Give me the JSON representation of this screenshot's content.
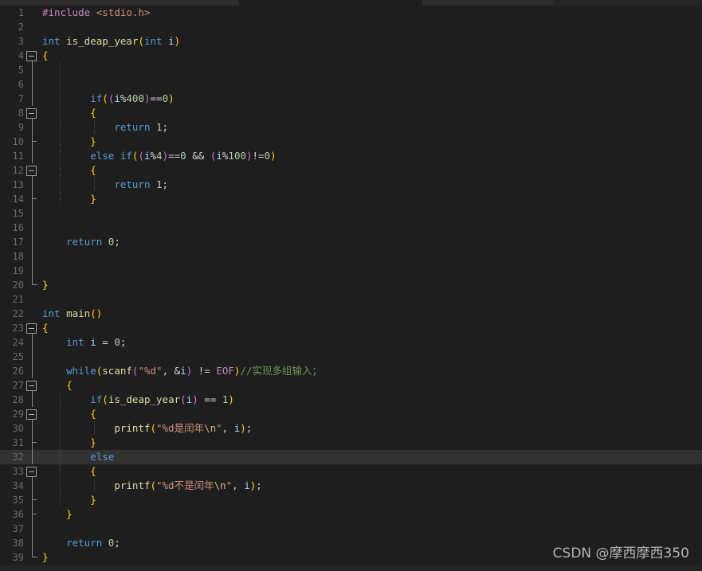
{
  "editor": {
    "language": "C",
    "theme": "dark-plus",
    "current_line": 32,
    "first_line": 1,
    "last_line": 39,
    "line_height_px": 18,
    "colors": {
      "background": "#1e1e1e",
      "current_line_background": "#323232",
      "gutter_foreground": "#6a6a6a",
      "keyword": "#569cd6",
      "function": "#dcdcaa",
      "string": "#ce9178",
      "number": "#b5cea8",
      "comment": "#6a9955",
      "variable": "#9cdcfe",
      "macro": "#c586c0",
      "escape": "#d7ba7d",
      "plain": "#d4d4d4"
    }
  },
  "watermark": {
    "text": "CSDN @摩西摩西350"
  },
  "code_lines": [
    {
      "n": 1,
      "fold": "none",
      "guides": [],
      "tokens": [
        {
          "c": "macro",
          "t": "#include"
        },
        {
          "c": "plain",
          "t": " "
        },
        {
          "c": "hdr",
          "t": "<stdio.h>"
        }
      ]
    },
    {
      "n": 2,
      "fold": "none",
      "guides": [],
      "tokens": []
    },
    {
      "n": 3,
      "fold": "none",
      "guides": [],
      "tokens": [
        {
          "c": "type",
          "t": "int"
        },
        {
          "c": "plain",
          "t": " "
        },
        {
          "c": "fn",
          "t": "is_deap_year"
        },
        {
          "c": "brace3",
          "t": "("
        },
        {
          "c": "type",
          "t": "int"
        },
        {
          "c": "plain",
          "t": " "
        },
        {
          "c": "var",
          "t": "i"
        },
        {
          "c": "brace3",
          "t": ")"
        }
      ]
    },
    {
      "n": 4,
      "fold": "open",
      "guides": [],
      "tokens": [
        {
          "c": "brace3",
          "t": "{"
        }
      ]
    },
    {
      "n": 5,
      "fold": "stem",
      "guides": [
        75
      ],
      "tokens": []
    },
    {
      "n": 6,
      "fold": "stem",
      "guides": [
        75
      ],
      "tokens": []
    },
    {
      "n": 7,
      "fold": "stem",
      "guides": [
        75
      ],
      "tokens": [
        {
          "c": "plain",
          "t": "        "
        },
        {
          "c": "kw",
          "t": "if"
        },
        {
          "c": "brace3",
          "t": "("
        },
        {
          "c": "brace",
          "t": "("
        },
        {
          "c": "var",
          "t": "i"
        },
        {
          "c": "op",
          "t": "%"
        },
        {
          "c": "num",
          "t": "400"
        },
        {
          "c": "brace",
          "t": ")"
        },
        {
          "c": "op",
          "t": "=="
        },
        {
          "c": "num",
          "t": "0"
        },
        {
          "c": "brace3",
          "t": ")"
        }
      ]
    },
    {
      "n": 8,
      "fold": "open",
      "guides": [
        75
      ],
      "tokens": [
        {
          "c": "plain",
          "t": "        "
        },
        {
          "c": "brace3",
          "t": "{"
        }
      ]
    },
    {
      "n": 9,
      "fold": "stem",
      "guides": [
        75,
        118
      ],
      "tokens": [
        {
          "c": "plain",
          "t": "            "
        },
        {
          "c": "kw",
          "t": "return"
        },
        {
          "c": "plain",
          "t": " "
        },
        {
          "c": "num",
          "t": "1"
        },
        {
          "c": "punc",
          "t": ";"
        }
      ]
    },
    {
      "n": 10,
      "fold": "end",
      "guides": [
        75
      ],
      "tokens": [
        {
          "c": "plain",
          "t": "        "
        },
        {
          "c": "brace3",
          "t": "}"
        }
      ]
    },
    {
      "n": 11,
      "fold": "stem",
      "guides": [
        75
      ],
      "tokens": [
        {
          "c": "plain",
          "t": "        "
        },
        {
          "c": "kw",
          "t": "else"
        },
        {
          "c": "plain",
          "t": " "
        },
        {
          "c": "kw",
          "t": "if"
        },
        {
          "c": "brace3",
          "t": "("
        },
        {
          "c": "brace",
          "t": "("
        },
        {
          "c": "var",
          "t": "i"
        },
        {
          "c": "op",
          "t": "%"
        },
        {
          "c": "num",
          "t": "4"
        },
        {
          "c": "brace",
          "t": ")"
        },
        {
          "c": "op",
          "t": "=="
        },
        {
          "c": "num",
          "t": "0"
        },
        {
          "c": "plain",
          "t": " "
        },
        {
          "c": "op",
          "t": "&&"
        },
        {
          "c": "plain",
          "t": " "
        },
        {
          "c": "brace",
          "t": "("
        },
        {
          "c": "var",
          "t": "i"
        },
        {
          "c": "op",
          "t": "%"
        },
        {
          "c": "num",
          "t": "100"
        },
        {
          "c": "brace",
          "t": ")"
        },
        {
          "c": "op",
          "t": "!="
        },
        {
          "c": "num",
          "t": "0"
        },
        {
          "c": "brace3",
          "t": ")"
        }
      ]
    },
    {
      "n": 12,
      "fold": "open",
      "guides": [
        75
      ],
      "tokens": [
        {
          "c": "plain",
          "t": "        "
        },
        {
          "c": "brace3",
          "t": "{"
        }
      ]
    },
    {
      "n": 13,
      "fold": "stem",
      "guides": [
        75,
        118
      ],
      "tokens": [
        {
          "c": "plain",
          "t": "            "
        },
        {
          "c": "kw",
          "t": "return"
        },
        {
          "c": "plain",
          "t": " "
        },
        {
          "c": "num",
          "t": "1"
        },
        {
          "c": "punc",
          "t": ";"
        }
      ]
    },
    {
      "n": 14,
      "fold": "end",
      "guides": [
        75
      ],
      "tokens": [
        {
          "c": "plain",
          "t": "        "
        },
        {
          "c": "brace3",
          "t": "}"
        }
      ]
    },
    {
      "n": 15,
      "fold": "stem",
      "guides": [],
      "tokens": []
    },
    {
      "n": 16,
      "fold": "stem",
      "guides": [],
      "tokens": []
    },
    {
      "n": 17,
      "fold": "stem",
      "guides": [],
      "tokens": [
        {
          "c": "plain",
          "t": "    "
        },
        {
          "c": "kw",
          "t": "return"
        },
        {
          "c": "plain",
          "t": " "
        },
        {
          "c": "num",
          "t": "0"
        },
        {
          "c": "punc",
          "t": ";"
        }
      ]
    },
    {
      "n": 18,
      "fold": "stem",
      "guides": [],
      "tokens": []
    },
    {
      "n": 19,
      "fold": "stem",
      "guides": [],
      "tokens": []
    },
    {
      "n": 20,
      "fold": "close",
      "guides": [],
      "tokens": [
        {
          "c": "brace3",
          "t": "}"
        }
      ]
    },
    {
      "n": 21,
      "fold": "none",
      "guides": [],
      "tokens": []
    },
    {
      "n": 22,
      "fold": "none",
      "guides": [],
      "tokens": [
        {
          "c": "type",
          "t": "int"
        },
        {
          "c": "plain",
          "t": " "
        },
        {
          "c": "fn",
          "t": "main"
        },
        {
          "c": "brace3",
          "t": "()"
        }
      ]
    },
    {
      "n": 23,
      "fold": "open",
      "guides": [],
      "tokens": [
        {
          "c": "brace3",
          "t": "{"
        }
      ]
    },
    {
      "n": 24,
      "fold": "stem",
      "guides": [],
      "tokens": [
        {
          "c": "plain",
          "t": "    "
        },
        {
          "c": "type",
          "t": "int"
        },
        {
          "c": "plain",
          "t": " "
        },
        {
          "c": "var",
          "t": "i"
        },
        {
          "c": "plain",
          "t": " "
        },
        {
          "c": "op",
          "t": "="
        },
        {
          "c": "plain",
          "t": " "
        },
        {
          "c": "num",
          "t": "0"
        },
        {
          "c": "punc",
          "t": ";"
        }
      ]
    },
    {
      "n": 25,
      "fold": "stem",
      "guides": [],
      "tokens": []
    },
    {
      "n": 26,
      "fold": "stem",
      "guides": [],
      "tokens": [
        {
          "c": "plain",
          "t": "    "
        },
        {
          "c": "kw",
          "t": "while"
        },
        {
          "c": "brace3",
          "t": "("
        },
        {
          "c": "fn",
          "t": "scanf"
        },
        {
          "c": "brace",
          "t": "("
        },
        {
          "c": "str",
          "t": "\"%d\""
        },
        {
          "c": "punc",
          "t": ","
        },
        {
          "c": "plain",
          "t": " "
        },
        {
          "c": "op",
          "t": "&"
        },
        {
          "c": "var",
          "t": "i"
        },
        {
          "c": "brace",
          "t": ")"
        },
        {
          "c": "plain",
          "t": " "
        },
        {
          "c": "op",
          "t": "!="
        },
        {
          "c": "plain",
          "t": " "
        },
        {
          "c": "const",
          "t": "EOF"
        },
        {
          "c": "brace3",
          "t": ")"
        },
        {
          "c": "com",
          "t": "//实现多组输入；"
        }
      ]
    },
    {
      "n": 27,
      "fold": "open",
      "guides": [],
      "tokens": [
        {
          "c": "plain",
          "t": "    "
        },
        {
          "c": "brace3",
          "t": "{"
        }
      ]
    },
    {
      "n": 28,
      "fold": "stem",
      "guides": [
        75
      ],
      "tokens": [
        {
          "c": "plain",
          "t": "        "
        },
        {
          "c": "kw",
          "t": "if"
        },
        {
          "c": "brace3",
          "t": "("
        },
        {
          "c": "fn",
          "t": "is_deap_year"
        },
        {
          "c": "brace",
          "t": "("
        },
        {
          "c": "var",
          "t": "i"
        },
        {
          "c": "brace",
          "t": ")"
        },
        {
          "c": "plain",
          "t": " "
        },
        {
          "c": "op",
          "t": "=="
        },
        {
          "c": "plain",
          "t": " "
        },
        {
          "c": "num",
          "t": "1"
        },
        {
          "c": "brace3",
          "t": ")"
        }
      ]
    },
    {
      "n": 29,
      "fold": "open",
      "guides": [
        75
      ],
      "tokens": [
        {
          "c": "plain",
          "t": "        "
        },
        {
          "c": "brace3",
          "t": "{"
        }
      ]
    },
    {
      "n": 30,
      "fold": "stem",
      "guides": [
        75,
        118
      ],
      "tokens": [
        {
          "c": "plain",
          "t": "            "
        },
        {
          "c": "fn",
          "t": "printf"
        },
        {
          "c": "brace3",
          "t": "("
        },
        {
          "c": "str",
          "t": "\"%d是闰年"
        },
        {
          "c": "esc",
          "t": "\\n"
        },
        {
          "c": "str",
          "t": "\""
        },
        {
          "c": "punc",
          "t": ","
        },
        {
          "c": "plain",
          "t": " "
        },
        {
          "c": "var",
          "t": "i"
        },
        {
          "c": "brace3",
          "t": ")"
        },
        {
          "c": "punc",
          "t": ";"
        }
      ]
    },
    {
      "n": 31,
      "fold": "end",
      "guides": [
        75
      ],
      "tokens": [
        {
          "c": "plain",
          "t": "        "
        },
        {
          "c": "brace3",
          "t": "}"
        }
      ]
    },
    {
      "n": 32,
      "fold": "stem",
      "guides": [
        75
      ],
      "current": true,
      "tokens": [
        {
          "c": "plain",
          "t": "        "
        },
        {
          "c": "kw",
          "t": "else"
        }
      ]
    },
    {
      "n": 33,
      "fold": "open",
      "guides": [
        75
      ],
      "tokens": [
        {
          "c": "plain",
          "t": "        "
        },
        {
          "c": "brace3",
          "t": "{"
        }
      ]
    },
    {
      "n": 34,
      "fold": "stem",
      "guides": [
        75,
        118
      ],
      "tokens": [
        {
          "c": "plain",
          "t": "            "
        },
        {
          "c": "fn",
          "t": "printf"
        },
        {
          "c": "brace3",
          "t": "("
        },
        {
          "c": "str",
          "t": "\"%d不是闰年"
        },
        {
          "c": "esc",
          "t": "\\n"
        },
        {
          "c": "str",
          "t": "\""
        },
        {
          "c": "punc",
          "t": ","
        },
        {
          "c": "plain",
          "t": " "
        },
        {
          "c": "var",
          "t": "i"
        },
        {
          "c": "brace3",
          "t": ")"
        },
        {
          "c": "punc",
          "t": ";"
        }
      ]
    },
    {
      "n": 35,
      "fold": "end",
      "guides": [
        75
      ],
      "tokens": [
        {
          "c": "plain",
          "t": "        "
        },
        {
          "c": "brace3",
          "t": "}"
        }
      ]
    },
    {
      "n": 36,
      "fold": "end",
      "guides": [],
      "tokens": [
        {
          "c": "plain",
          "t": "    "
        },
        {
          "c": "brace3",
          "t": "}"
        }
      ]
    },
    {
      "n": 37,
      "fold": "stem",
      "guides": [],
      "tokens": []
    },
    {
      "n": 38,
      "fold": "stem",
      "guides": [],
      "tokens": [
        {
          "c": "plain",
          "t": "    "
        },
        {
          "c": "kw",
          "t": "return"
        },
        {
          "c": "plain",
          "t": " "
        },
        {
          "c": "num",
          "t": "0"
        },
        {
          "c": "punc",
          "t": ";"
        }
      ]
    },
    {
      "n": 39,
      "fold": "close",
      "guides": [],
      "tokens": [
        {
          "c": "brace3",
          "t": "}"
        }
      ]
    }
  ]
}
